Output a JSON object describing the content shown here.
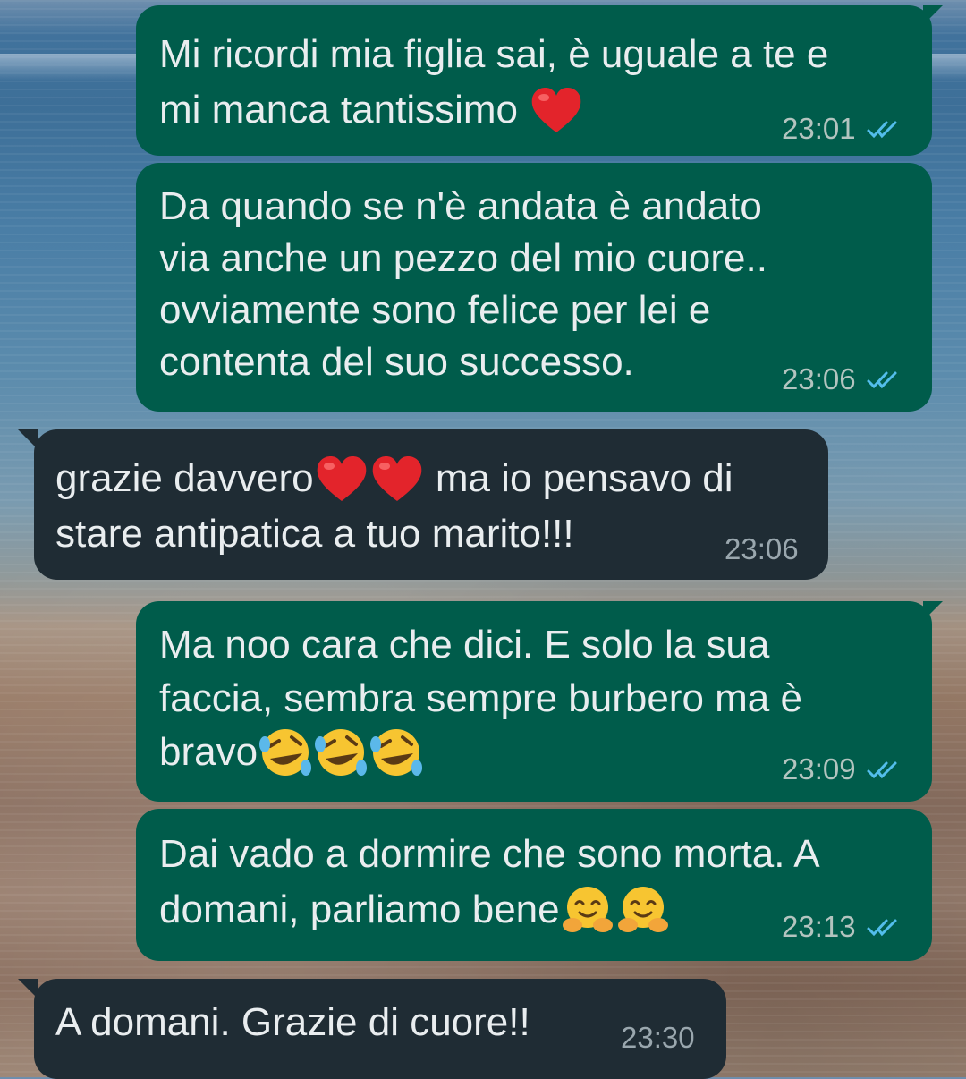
{
  "chat": {
    "messages": [
      {
        "direction": "outgoing",
        "line1": "Mi ricordi mia figlia sai, è uguale a te e",
        "line2": "mi manca tantissimo ",
        "emoji": "red-heart",
        "time": "23:01",
        "status": "read"
      },
      {
        "direction": "outgoing",
        "lines": [
          "Da quando se n'è andata è andato",
          "via anche un pezzo del mio cuore..",
          "ovviamente sono felice per lei e",
          "contenta del suo successo."
        ],
        "time": "23:06",
        "status": "read"
      },
      {
        "direction": "incoming",
        "line1_a": "grazie davvero",
        "line1_b": " ma io pensavo di",
        "line2": "stare antipatica a tuo marito!!!",
        "emoji": "red-heart x2",
        "time": "23:06"
      },
      {
        "direction": "outgoing",
        "lines": [
          "Ma noo cara che dici. E solo la sua",
          "faccia, sembra sempre burbero ma è"
        ],
        "line3": "bravo",
        "emoji": "rolling-on-floor-laughing x3",
        "time": "23:09",
        "status": "read"
      },
      {
        "direction": "outgoing",
        "line1": "Dai vado a dormire che sono morta. A",
        "line2": "domani, parliamo bene",
        "emoji": "hugging-face x2",
        "time": "23:13",
        "status": "read"
      },
      {
        "direction": "incoming",
        "line1": "A domani. Grazie di cuore!!",
        "time": "23:30"
      }
    ]
  },
  "colors": {
    "outgoing_bubble": "#005c4b",
    "incoming_bubble": "#1f2c34",
    "text": "#e9edef",
    "read_tick": "#53bdeb"
  }
}
